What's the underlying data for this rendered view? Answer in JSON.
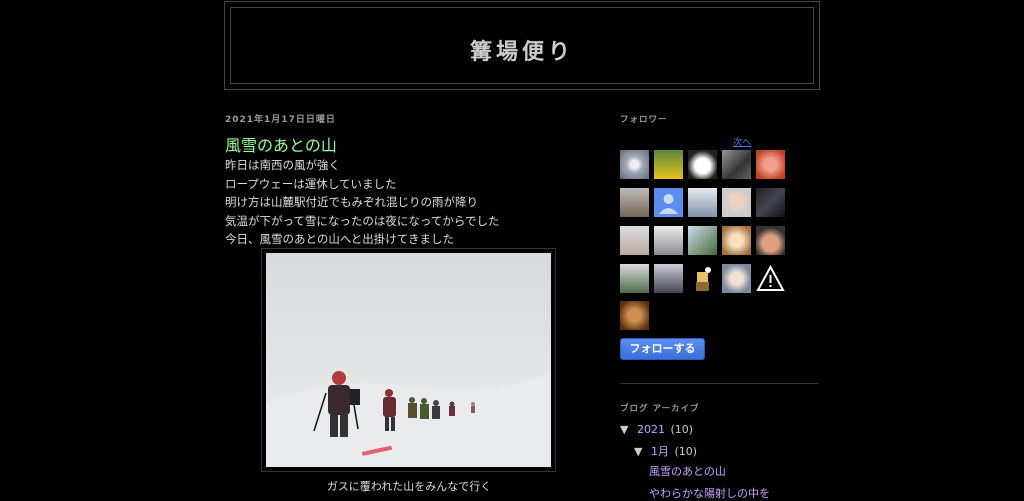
{
  "blog": {
    "title": "篝場便り"
  },
  "post": {
    "date": "2021年1月17日日曜日",
    "title": "風雪のあとの山",
    "lines": [
      "昨日は南西の風が強く",
      "ロープウェーは運休していました",
      "明け方は山麓駅付近でもみぞれ混じりの雨が降り",
      "気温が下がって雪になったのは夜になってからでした",
      "今日、風雪のあとの山へと出掛けてきました"
    ],
    "photo_caption": "ガスに覆われた山をみんなで行く"
  },
  "sidebar": {
    "followers_heading": "フォロワー",
    "next_link": "次へ",
    "follow_button": "フォローする",
    "archive_heading": "ブログ アーカイブ",
    "archive": {
      "year_toggle": "▼",
      "year": "2021",
      "year_count": "(10)",
      "month_toggle": "▼",
      "month": "1月",
      "month_count": "(10)",
      "posts": [
        "風雪のあとの山",
        "やわらかな陽射しの中を"
      ]
    }
  },
  "colors": {
    "background": "#000000",
    "title_green": "#99ff99",
    "link_purple": "#c8a0ff",
    "button_blue": "#3b6fd8"
  }
}
